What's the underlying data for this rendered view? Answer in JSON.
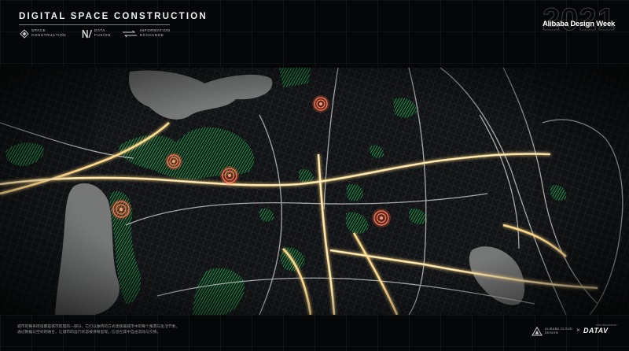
{
  "header": {
    "title": "DIGITAL SPACE CONSTRUCTION",
    "tags": [
      {
        "icon": "diamond-icon",
        "line1": "SPACE",
        "line2": "CONSTRUCTION"
      },
      {
        "icon": "data-fusion-icon",
        "line1": "DATA",
        "line2": "FUSION"
      },
      {
        "icon": "exchange-arrows-icon",
        "line1": "INFORMATION",
        "line2": "EXCHANGE"
      }
    ],
    "year": "2021",
    "brand": "Alibaba Design Week"
  },
  "map": {
    "hotspot_color": "#ff5a3c",
    "road_glow_color": "#ffd98a",
    "green_zone_color": "#3fd67a",
    "water_color": "#8c8c8c"
  },
  "footer": {
    "description_lines": [
      "城市的每条街道都是城市肌理的一部分，它们以独特的方式连接着城市中的每个角落与生活节奏。",
      "通过数据与空间的融合，让城市的运行状态被清晰呈现，信息在其中自由流动与交换。"
    ],
    "partner_left_line1": "ALIBABA CLOUD",
    "partner_left_line2": "DESIGN",
    "separator": "×",
    "partner_right": "DATAV",
    "partner_right_sub": "DATA VISUALIZATION"
  }
}
